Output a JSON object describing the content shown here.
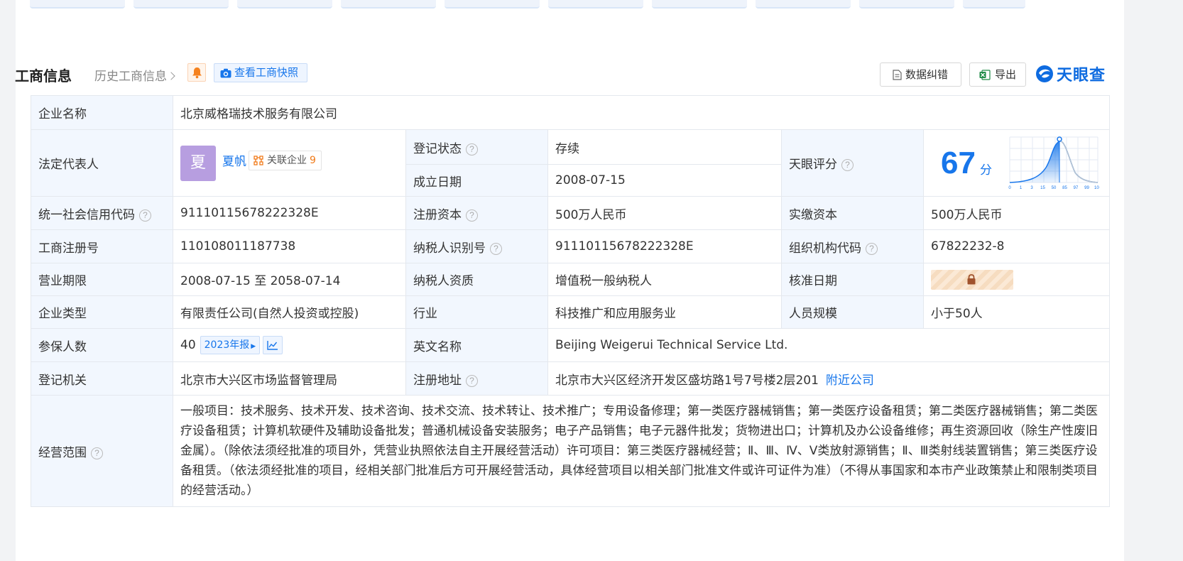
{
  "header": {
    "title": "工商信息",
    "history_link": "历史工商信息",
    "snapshot_btn": "查看工商快照",
    "correct_btn": "数据纠错",
    "export_btn": "导出",
    "logo_text": "天眼查"
  },
  "rows": {
    "company_name": {
      "label": "企业名称",
      "value": "北京威格瑞技术服务有限公司"
    },
    "legal_rep": {
      "label": "法定代表人",
      "avatar_char": "夏",
      "name": "夏帆",
      "related_label": "关联企业",
      "related_count": "9"
    },
    "reg_status": {
      "label": "登记状态",
      "value": "存续"
    },
    "est_date": {
      "label": "成立日期",
      "value": "2008-07-15"
    },
    "score": {
      "label": "天眼评分",
      "value": "67",
      "unit": "分",
      "axis_ticks": [
        "0",
        "1",
        "3",
        "15",
        "50",
        "85",
        "97",
        "99",
        "100"
      ]
    },
    "credit_code": {
      "label": "统一社会信用代码",
      "value": "91110115678222328E"
    },
    "reg_capital": {
      "label": "注册资本",
      "value": "500万人民币"
    },
    "paid_capital": {
      "label": "实缴资本",
      "value": "500万人民币"
    },
    "reg_no": {
      "label": "工商注册号",
      "value": "110108011187738"
    },
    "taxpayer_id": {
      "label": "纳税人识别号",
      "value": "91110115678222328E"
    },
    "org_code": {
      "label": "组织机构代码",
      "value": "67822232-8"
    },
    "business_term": {
      "label": "营业期限",
      "value": "2008-07-15 至 2058-07-14"
    },
    "taxpayer_qual": {
      "label": "纳税人资质",
      "value": "增值税一般纳税人"
    },
    "approval_date": {
      "label": "核准日期"
    },
    "company_type": {
      "label": "企业类型",
      "value": "有限责任公司(自然人投资或控股)"
    },
    "industry": {
      "label": "行业",
      "value": "科技推广和应用服务业"
    },
    "staff_size": {
      "label": "人员规模",
      "value": "小于50人"
    },
    "insured": {
      "label": "参保人数",
      "value": "40",
      "year_badge": "2023年报"
    },
    "english_name": {
      "label": "英文名称",
      "value": "Beijing Weigerui Technical Service Ltd."
    },
    "reg_authority": {
      "label": "登记机关",
      "value": "北京市大兴区市场监督管理局"
    },
    "reg_address": {
      "label": "注册地址",
      "value": "北京市大兴区经济开发区盛坊路1号7号楼2层201",
      "nearby_link": "附近公司"
    },
    "scope": {
      "label": "经营范围",
      "value": "一般项目：技术服务、技术开发、技术咨询、技术交流、技术转让、技术推广；专用设备修理；第一类医疗器械销售；第一类医疗设备租赁；第二类医疗器械销售；第二类医疗设备租赁；计算机软硬件及辅助设备批发；普通机械设备安装服务；电子产品销售；电子元器件批发；货物进出口；计算机及办公设备维修；再生资源回收（除生产性废旧金属）。（除依法须经批准的项目外，凭营业执照依法自主开展经营活动）许可项目：第三类医疗器械经营；Ⅱ、Ⅲ、Ⅳ、Ⅴ类放射源销售；Ⅱ、Ⅲ类射线装置销售；第三类医疗设备租赁。（依法须经批准的项目，经相关部门批准后方可开展经营活动，具体经营项目以相关部门批准文件或许可证件为准）（不得从事国家和本市产业政策禁止和限制类项目的经营活动。）"
    }
  },
  "colors": {
    "accent": "#1776eb",
    "status_green": "#17a35b",
    "label_bg": "#f2f7fe",
    "avatar_bg": "#b79ee0",
    "badge_orange": "#f07a18"
  },
  "icons": {
    "bell": "bell-icon",
    "camera": "camera-icon",
    "doc": "document-icon",
    "excel": "excel-icon",
    "logo": "tianyancha-logo-icon",
    "related": "network-icon",
    "trend": "trend-chart-icon",
    "lock": "lock-icon",
    "help": "help-icon"
  }
}
